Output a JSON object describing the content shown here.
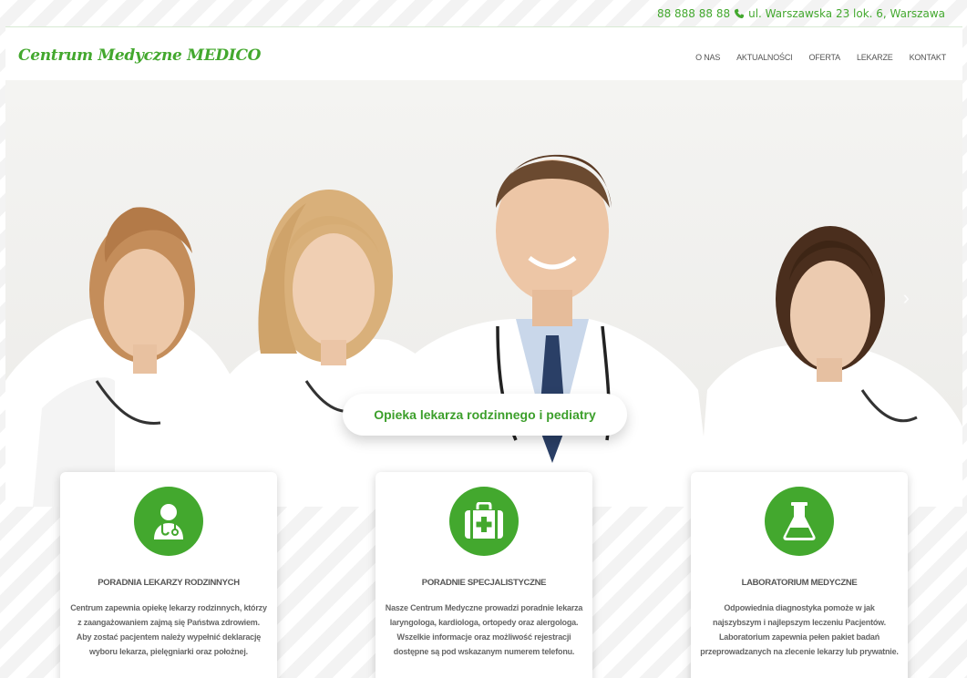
{
  "topbar": {
    "phone": "88 888 88 88",
    "address": "ul. Warszawska 23 lok. 6, Warszawa"
  },
  "header": {
    "logo": "Centrum Medyczne MEDICO",
    "nav": [
      "O NAS",
      "AKTUALNOŚCI",
      "OFERTA",
      "LEKARZE",
      "KONTAKT"
    ]
  },
  "hero": {
    "caption": "Opieka lekarza rodzinnego i pediatry"
  },
  "cards": [
    {
      "icon": "doctor-icon",
      "title": "PORADNIA LEKARZY RODZINNYCH",
      "text": "Centrum zapewnia opiekę lekarzy rodzinnych, którzy z zaangażowaniem zajmą się Państwa zdrowiem. Aby zostać pacjentem należy wypełnić deklarację wyboru lekarza, pielęgniarki oraz położnej."
    },
    {
      "icon": "medical-kit-icon",
      "title": "PORADNIE SPECJALISTYCZNE",
      "text": "Nasze Centrum Medyczne prowadzi poradnie lekarza laryngologa, kardiologa, ortopedy oraz alergologa. Wszelkie informacje oraz możliwość rejestracji dostępne są pod wskazanym numerem telefonu."
    },
    {
      "icon": "flask-icon",
      "title": "LABORATORIUM MEDYCZNE",
      "text": "Odpowiednia diagnostyka pomoże w jak najszybszym i najlepszym leczeniu Pacjentów. Laboratorium zapewnia pełen pakiet badań przeprowadzanych na zlecenie lekarzy lub prywatnie."
    }
  ],
  "colors": {
    "brand_green": "#43a82e",
    "text_gray": "#555555"
  }
}
